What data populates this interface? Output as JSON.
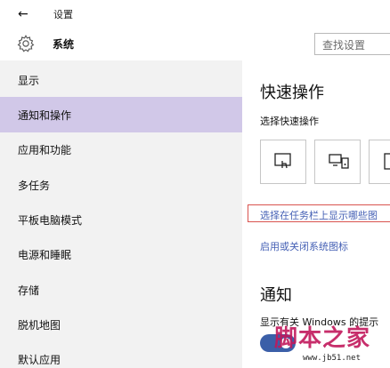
{
  "titlebar": {
    "back_glyph": "←",
    "title": "设置"
  },
  "header": {
    "title": "系统",
    "search_placeholder": "查找设置"
  },
  "sidebar": {
    "items": [
      {
        "label": "显示",
        "selected": false
      },
      {
        "label": "通知和操作",
        "selected": true
      },
      {
        "label": "应用和功能",
        "selected": false
      },
      {
        "label": "多任务",
        "selected": false
      },
      {
        "label": "平板电脑模式",
        "selected": false
      },
      {
        "label": "电源和睡眠",
        "selected": false
      },
      {
        "label": "存储",
        "selected": false
      },
      {
        "label": "脱机地图",
        "selected": false
      },
      {
        "label": "默认应用",
        "selected": false
      }
    ]
  },
  "main": {
    "quick_actions_title": "快速操作",
    "quick_actions_subtitle": "选择快速操作",
    "quick_action_tiles": [
      {
        "icon": "tablet-mode-icon"
      },
      {
        "icon": "connect-icon"
      },
      {
        "icon": "note-icon"
      }
    ],
    "link_taskbar_icons": "选择在任务栏上显示哪些图",
    "link_system_icons": "启用或关闭系统图标",
    "notifications_title": "通知",
    "notifications_desc": "显示有关 Windows 的提示",
    "notifications_toggle_on": true
  },
  "watermark": {
    "logo_text": "脚本之家",
    "url": "www.jb51.net"
  },
  "colors": {
    "selected_bg": "#d1c8e8",
    "link": "#4661b5",
    "highlight_box": "#d9534f",
    "sidebar_bg": "#f2f2f2",
    "watermark": "#c2185b"
  }
}
